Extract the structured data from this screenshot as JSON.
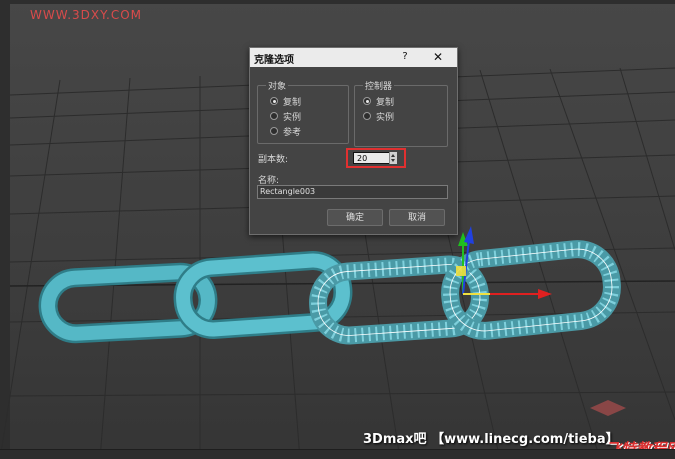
{
  "watermark": {
    "top": "WWW.3DXY.COM",
    "bottom": "3Dmax吧 【www.linecg.com/tieba】",
    "logo": "飞特教程网"
  },
  "dialog": {
    "title": "克隆选项",
    "help_label": "?",
    "close_label": "✕",
    "object_group": {
      "label": "对象",
      "options": [
        {
          "label": "复制",
          "selected": true
        },
        {
          "label": "实例",
          "selected": false
        },
        {
          "label": "参考",
          "selected": false
        }
      ]
    },
    "controller_group": {
      "label": "控制器",
      "options": [
        {
          "label": "复制",
          "selected": true
        },
        {
          "label": "实例",
          "selected": false
        }
      ]
    },
    "copies_label": "副本数:",
    "copies_value": "20",
    "name_label": "名称:",
    "name_value": "Rectangle003",
    "ok_label": "确定",
    "cancel_label": "取消"
  },
  "colors": {
    "chain": "#4fb4c4",
    "wire": "#ffffff",
    "highlight": "#e03030",
    "gizmo_x": "#e02020",
    "gizmo_y": "#20c020",
    "gizmo_z": "#2040e0"
  }
}
